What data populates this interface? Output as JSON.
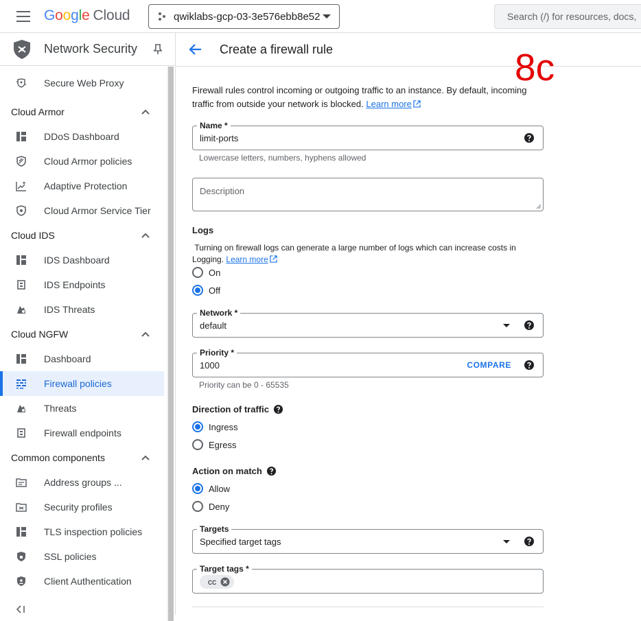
{
  "topbar": {
    "logo_google": "Google",
    "logo_cloud": "Cloud",
    "project_name": "qwiklabs-gcp-03-3e576ebb8e52",
    "search_placeholder": "Search (/) for resources, docs, products, and more"
  },
  "sidebar": {
    "product_title": "Network Security",
    "items_top": [
      {
        "label": "Secure Web Proxy",
        "icon": "proxy-icon"
      }
    ],
    "sections": [
      {
        "title": "Cloud Armor",
        "items": [
          {
            "label": "DDoS Dashboard",
            "icon": "dashboard-icon"
          },
          {
            "label": "Cloud Armor policies",
            "icon": "shield-policy-icon"
          },
          {
            "label": "Adaptive Protection",
            "icon": "adaptive-chart-icon"
          },
          {
            "label": "Cloud Armor Service Tier",
            "icon": "shield-tier-icon"
          }
        ]
      },
      {
        "title": "Cloud IDS",
        "items": [
          {
            "label": "IDS Dashboard",
            "icon": "dashboard-icon"
          },
          {
            "label": "IDS Endpoints",
            "icon": "endpoint-icon"
          },
          {
            "label": "IDS Threats",
            "icon": "threat-icon"
          }
        ]
      },
      {
        "title": "Cloud NGFW",
        "items": [
          {
            "label": "Dashboard",
            "icon": "dashboard-icon"
          },
          {
            "label": "Firewall policies",
            "icon": "firewall-icon",
            "active": true
          },
          {
            "label": "Threats",
            "icon": "threat-icon"
          },
          {
            "label": "Firewall endpoints",
            "icon": "endpoint-icon"
          }
        ]
      },
      {
        "title": "Common components",
        "items": [
          {
            "label": "Address groups ...",
            "icon": "address-group-icon"
          },
          {
            "label": "Security profiles",
            "icon": "security-profile-icon"
          },
          {
            "label": "TLS inspection policies",
            "icon": "dashboard-icon"
          },
          {
            "label": "SSL policies",
            "icon": "ssl-shield-icon"
          },
          {
            "label": "Client Authentication",
            "icon": "client-auth-shield-icon"
          }
        ]
      }
    ],
    "collapse_label": "<|"
  },
  "main": {
    "title": "Create a firewall rule",
    "stamp": "8c",
    "intro_text": "Firewall rules control incoming or outgoing traffic to an instance. By default, incoming traffic from outside your network is blocked.",
    "learn_more": "Learn more",
    "name": {
      "label": "Name *",
      "value": "limit-ports",
      "hint": "Lowercase letters, numbers, hyphens allowed"
    },
    "description": {
      "placeholder": "Description"
    },
    "logs": {
      "title": "Logs",
      "text": "Turning on firewall logs can generate a large number of logs which can increase costs in Logging.",
      "learn_more": "Learn more",
      "options": [
        "On",
        "Off"
      ],
      "selected": "Off"
    },
    "network": {
      "label": "Network *",
      "value": "default"
    },
    "priority": {
      "label": "Priority *",
      "value": "1000",
      "compare": "COMPARE",
      "hint": "Priority can be 0 - 65535"
    },
    "direction": {
      "title": "Direction of traffic",
      "options": [
        "Ingress",
        "Egress"
      ],
      "selected": "Ingress"
    },
    "action": {
      "title": "Action on match",
      "options": [
        "Allow",
        "Deny"
      ],
      "selected": "Allow"
    },
    "targets": {
      "label": "Targets",
      "value": "Specified target tags"
    },
    "target_tags": {
      "label": "Target tags *",
      "chips": [
        "cc"
      ]
    }
  },
  "colors": {
    "accent": "#1a73e8",
    "active_bg": "#e8f0fe",
    "stamp": "#e30000"
  }
}
